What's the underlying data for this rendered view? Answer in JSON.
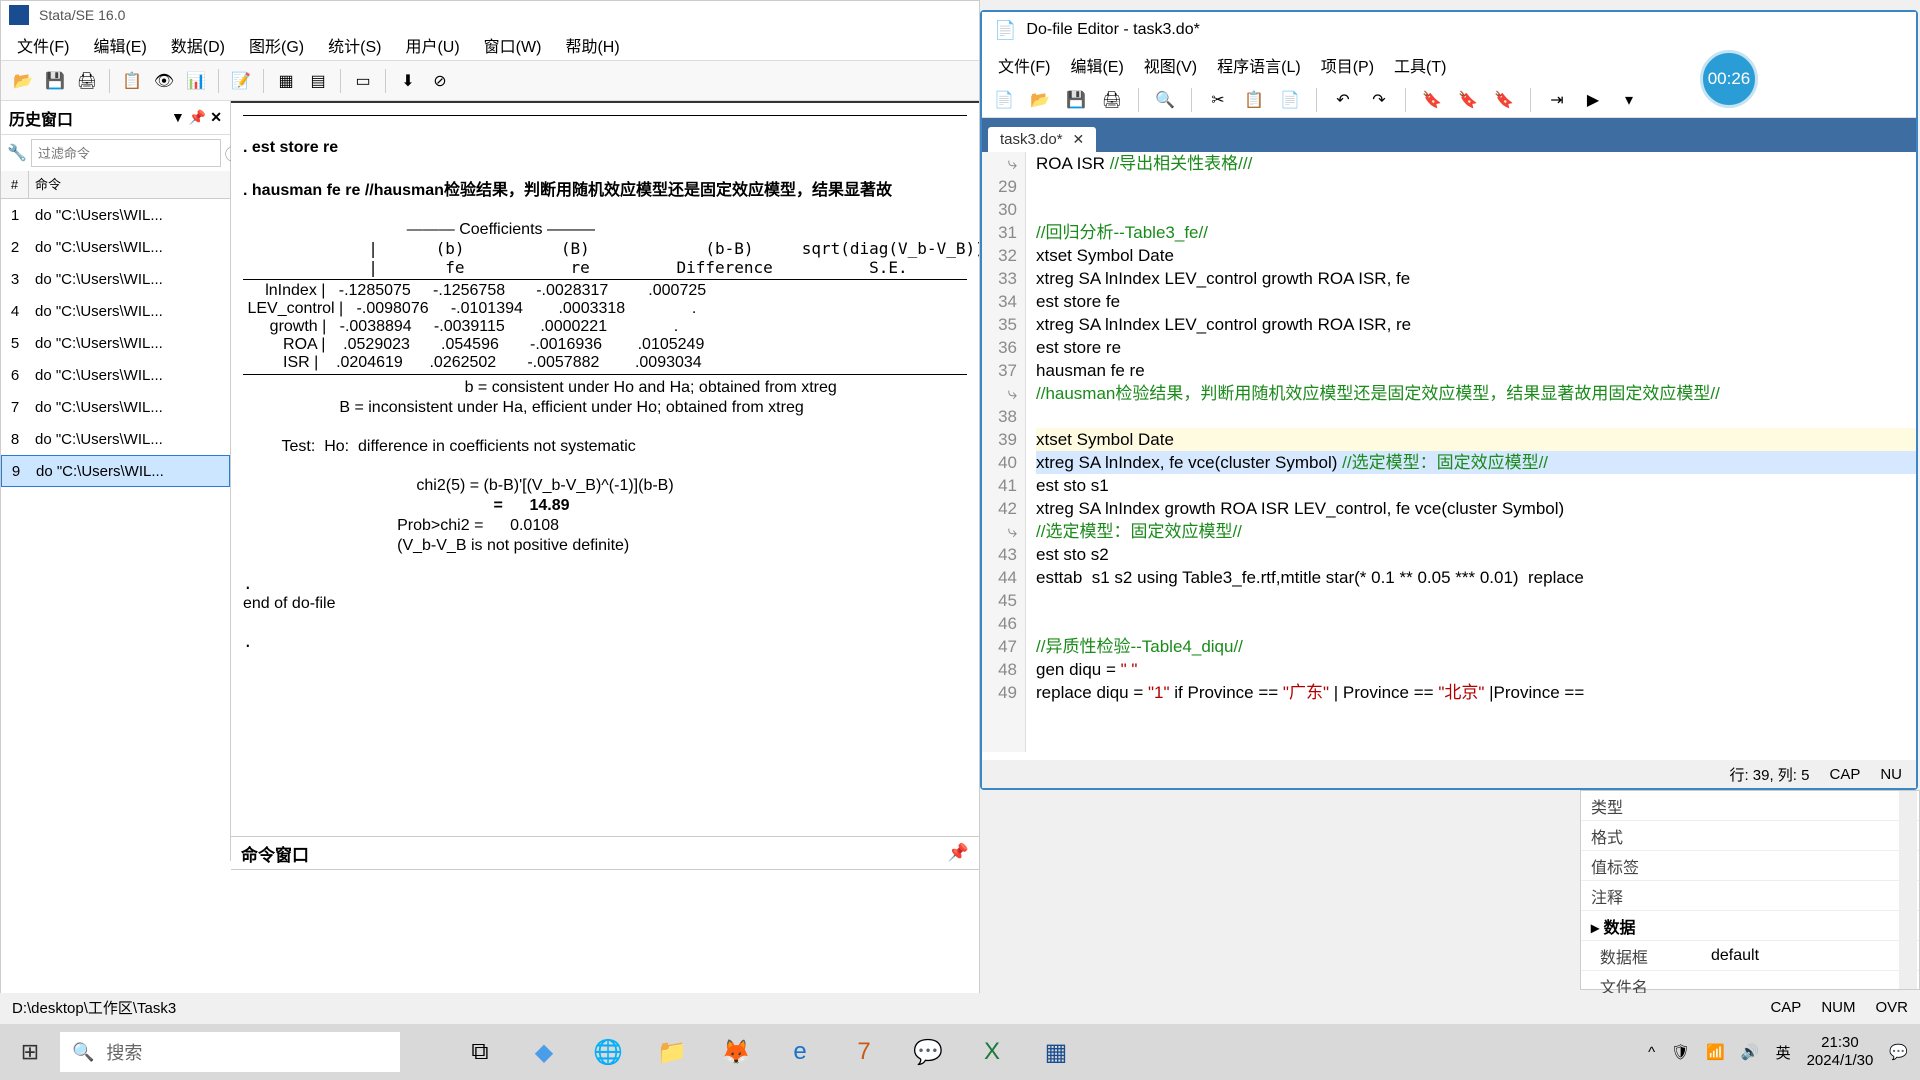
{
  "stata": {
    "title": "Stata/SE 16.0",
    "menus": [
      "文件(F)",
      "编辑(E)",
      "数据(D)",
      "图形(G)",
      "统计(S)",
      "用户(U)",
      "窗口(W)",
      "帮助(H)"
    ],
    "history": {
      "title": "历史窗口",
      "filter_placeholder": "过滤命令",
      "col_num": "#",
      "col_cmd": "命令",
      "items": [
        "do \"C:\\Users\\WIL...",
        "do \"C:\\Users\\WIL...",
        "do \"C:\\Users\\WIL...",
        "do \"C:\\Users\\WIL...",
        "do \"C:\\Users\\WIL...",
        "do \"C:\\Users\\WIL...",
        "do \"C:\\Users\\WIL...",
        "do \"C:\\Users\\WIL...",
        "do \"C:\\Users\\WIL..."
      ],
      "selected_index": 8
    },
    "results": {
      "line_store": ". est store re",
      "line_hausman": ". hausman fe re //hausman检验结果，判断用随机效应模型还是固定效应模型，结果显著故",
      "coef_header": "——— Coefficients ———",
      "cols": [
        "(b)",
        "(B)",
        "(b-B)",
        "sqrt(diag(V_b-V_B))"
      ],
      "subcols": [
        "fe",
        "re",
        "Difference",
        "S.E."
      ],
      "rows": [
        {
          "name": "lnIndex",
          "b": "-.1285075",
          "B": "-.1256758",
          "diff": "-.0028317",
          "se": ".000725"
        },
        {
          "name": "LEV_control",
          "b": "-.0098076",
          "B": "-.0101394",
          "diff": ".0003318",
          "se": "."
        },
        {
          "name": "growth",
          "b": "-.0038894",
          "B": "-.0039115",
          "diff": ".0000221",
          "se": "."
        },
        {
          "name": "ROA",
          "b": ".0529023",
          "B": ".054596",
          "diff": "-.0016936",
          "se": ".0105249"
        },
        {
          "name": "ISR",
          "b": ".0204619",
          "B": ".0262502",
          "diff": "-.0057882",
          "se": ".0093034"
        }
      ],
      "note1": "b = consistent under Ho and Ha; obtained from xtreg",
      "note2": "B = inconsistent under Ha, efficient under Ho; obtained from xtreg",
      "test_line": "Test:  Ho:  difference in coefficients not systematic",
      "chi2_expr": "chi2(5) = (b-B)'[(V_b-V_B)^(-1)](b-B)",
      "chi2_val": "=      14.89",
      "prob_line": "Prob>chi2 =      0.0108",
      "vbvb_line": "(V_b-V_B is not positive definite)",
      "end_line": "end of do-file"
    },
    "cmd_title": "命令窗口",
    "status_path": "D:\\desktop\\工作区\\Task3",
    "status_right": [
      "CAP",
      "NUM",
      "OVR"
    ]
  },
  "dofile": {
    "title": "Do-file Editor - task3.do*",
    "menus": [
      "文件(F)",
      "编辑(E)",
      "视图(V)",
      "程序语言(L)",
      "项目(P)",
      "工具(T)"
    ],
    "tab": "task3.do*",
    "gutter_start": 28,
    "lines": [
      {
        "n": "⤷",
        "raw": "ROA ISR ",
        "c": "//导出相关性表格///"
      },
      {
        "n": "29",
        "raw": ""
      },
      {
        "n": "30",
        "raw": ""
      },
      {
        "n": "31",
        "c": "//回归分析--Table3_fe//"
      },
      {
        "n": "32",
        "raw": "xtset Symbol Date"
      },
      {
        "n": "33",
        "raw": "xtreg SA lnIndex LEV_control growth ROA ISR, fe"
      },
      {
        "n": "34",
        "raw": "est store fe"
      },
      {
        "n": "35",
        "raw": "xtreg SA lnIndex LEV_control growth ROA ISR, re"
      },
      {
        "n": "36",
        "raw": "est store re"
      },
      {
        "n": "37",
        "raw": "hausman fe re"
      },
      {
        "n": "⤷",
        "c": "//hausman检验结果，判断用随机效应模型还是固定效应模型，结果显著故用固定效应模型//"
      },
      {
        "n": "38",
        "raw": ""
      },
      {
        "n": "39",
        "raw": "xtset Symbol Date",
        "current": true
      },
      {
        "n": "40",
        "raw": "xtreg SA lnIndex, fe vce(cluster Symbol) ",
        "c": "//选定模型：固定效应模型//",
        "hl": true
      },
      {
        "n": "41",
        "raw": "est sto s1"
      },
      {
        "n": "42",
        "raw": "xtreg SA lnIndex growth ROA ISR LEV_control, fe vce(cluster Symbol)"
      },
      {
        "n": "⤷",
        "c": "//选定模型：固定效应模型//"
      },
      {
        "n": "43",
        "raw": "est sto s2"
      },
      {
        "n": "44",
        "raw": "esttab  s1 s2 using Table3_fe.rtf,mtitle star(* 0.1 ** 0.05 *** 0.01)  replace"
      },
      {
        "n": "45",
        "raw": ""
      },
      {
        "n": "46",
        "raw": ""
      },
      {
        "n": "47",
        "c": "//异质性检验--Table4_diqu//"
      },
      {
        "n": "48",
        "raw": "gen diqu = ",
        "s": "\" \""
      },
      {
        "n": "49",
        "raw": "replace diqu = ",
        "s": "\"1\"",
        "raw2": " if Province == ",
        "s2": "\"广东\"",
        "raw3": " | Province == ",
        "s3": "\"北京\"",
        "raw4": " |Province =="
      }
    ],
    "status": {
      "pos": "行: 39, 列: 5",
      "cap": "CAP",
      "num": "NU"
    }
  },
  "timer": "00:26",
  "var_panel": {
    "rows": [
      {
        "label": "类型",
        "val": ""
      },
      {
        "label": "格式",
        "val": ""
      },
      {
        "label": "值标签",
        "val": ""
      },
      {
        "label": "注释",
        "val": ""
      }
    ],
    "group": "数据",
    "rows2": [
      {
        "label": "数据框",
        "val": "default"
      },
      {
        "label": "文件名",
        "val": ""
      }
    ]
  },
  "taskbar": {
    "search_placeholder": "搜索",
    "ime": "英",
    "time": "21:30",
    "date": "2024/1/30"
  }
}
